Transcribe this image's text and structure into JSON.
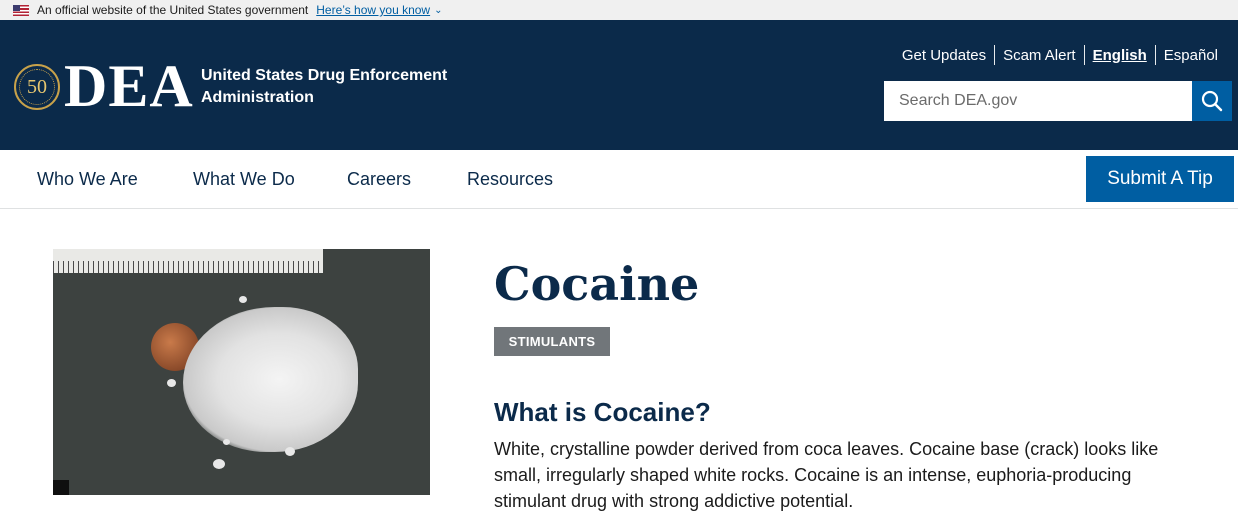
{
  "gov_banner": {
    "text": "An official website of the United States government",
    "link": "Here’s how you know"
  },
  "header": {
    "seal_text": "50",
    "logo_text": "DEA",
    "agency_name": "United States Drug Enforcement Administration",
    "utility_links": [
      "Get Updates",
      "Scam Alert",
      "English",
      "Español"
    ],
    "search_placeholder": "Search DEA.gov"
  },
  "nav": {
    "items": [
      "Who We Are",
      "What We Do",
      "Careers",
      "Resources"
    ],
    "tip_button": "Submit A Tip"
  },
  "main": {
    "title": "Cocaine",
    "tag": "STIMULANTS",
    "section_heading": "What is Cocaine?",
    "description": "White, crystalline powder derived from coca leaves. Cocaine base (crack) looks like small, irregularly shaped white rocks. Cocaine is an intense, euphoria-producing stimulant drug with strong addictive potential."
  },
  "colors": {
    "header_bg": "#0b2a4a",
    "accent": "#005ea2",
    "tag_bg": "#71767a"
  },
  "icons": {
    "flag": "us-flag-icon",
    "chevron": "chevron-down-icon",
    "search": "search-icon",
    "seal": "dea-50-seal-icon"
  }
}
